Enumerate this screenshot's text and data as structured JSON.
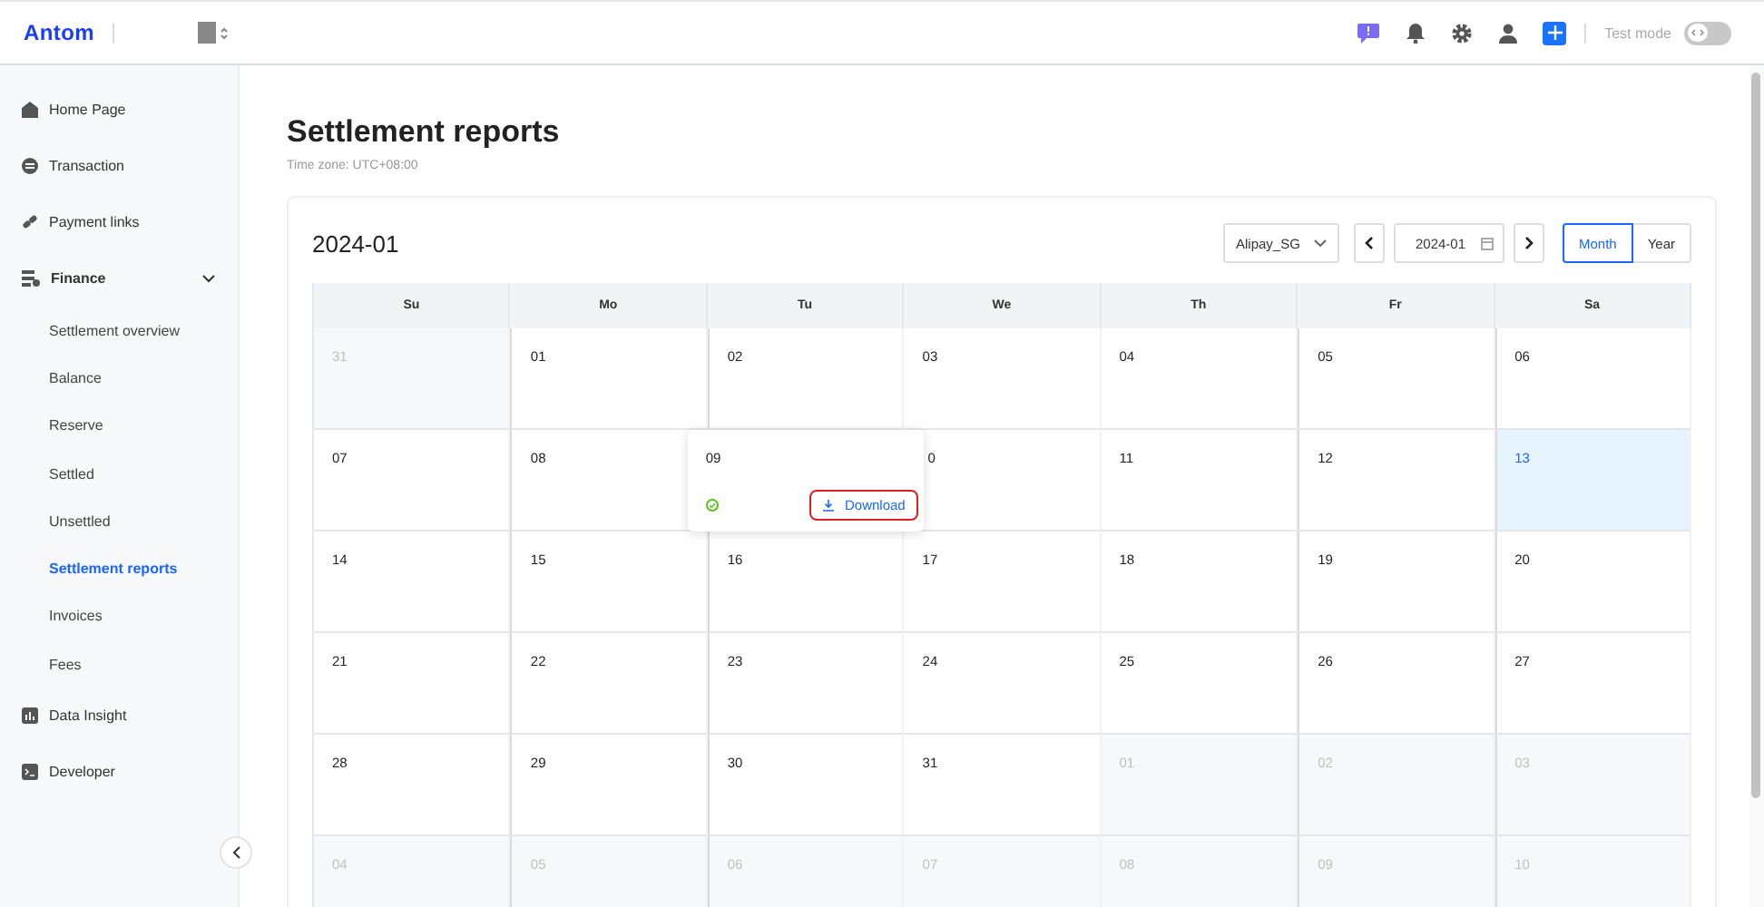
{
  "header": {
    "logo": "Antom",
    "test_mode": {
      "label": "Test mode",
      "on": false
    }
  },
  "sidebar": {
    "items": [
      {
        "label": "Home Page",
        "kind": "home",
        "expanded": false
      },
      {
        "label": "Transaction",
        "kind": "transaction",
        "expanded": false
      },
      {
        "label": "Payment links",
        "kind": "link",
        "expanded": false
      },
      {
        "label": "Finance",
        "kind": "finance",
        "expanded": true,
        "children": [
          {
            "label": "Settlement overview",
            "selected": false
          },
          {
            "label": "Balance",
            "selected": false
          },
          {
            "label": "Reserve",
            "selected": false
          },
          {
            "label": "Settled",
            "selected": false
          },
          {
            "label": "Unsettled",
            "selected": false
          },
          {
            "label": "Settlement reports",
            "selected": true
          },
          {
            "label": "Invoices",
            "selected": false
          },
          {
            "label": "Fees",
            "selected": false
          }
        ]
      },
      {
        "label": "Data Insight",
        "kind": "chart",
        "expanded": false
      },
      {
        "label": "Developer",
        "kind": "terminal",
        "expanded": false
      }
    ]
  },
  "page": {
    "title": "Settlement reports",
    "subtitle": "Time zone: UTC+08:00"
  },
  "calendar": {
    "period": "2024-01",
    "account": "Alipay_SG",
    "date": "2024-01",
    "views": [
      {
        "label": "Month",
        "selected": true
      },
      {
        "label": "Year",
        "selected": false
      }
    ],
    "weekdays": [
      "Su",
      "Mo",
      "Tu",
      "We",
      "Th",
      "Fr",
      "Sa"
    ],
    "weeks": [
      [
        {
          "day": "31",
          "in_month": false,
          "selected": false
        },
        {
          "day": "01",
          "in_month": true,
          "selected": false
        },
        {
          "day": "02",
          "in_month": true,
          "selected": false
        },
        {
          "day": "03",
          "in_month": true,
          "selected": false
        },
        {
          "day": "04",
          "in_month": true,
          "selected": false
        },
        {
          "day": "05",
          "in_month": true,
          "selected": false
        },
        {
          "day": "06",
          "in_month": true,
          "selected": false
        }
      ],
      [
        {
          "day": "07",
          "in_month": true,
          "selected": false
        },
        {
          "day": "08",
          "in_month": true,
          "selected": false
        },
        {
          "day": "09",
          "in_month": true,
          "selected": false,
          "popover": {
            "completed": true,
            "action": "Download",
            "highlighted": true
          }
        },
        {
          "day": "0",
          "in_month": true,
          "selected": false
        },
        {
          "day": "11",
          "in_month": true,
          "selected": false
        },
        {
          "day": "12",
          "in_month": true,
          "selected": false
        },
        {
          "day": "13",
          "in_month": true,
          "selected": true
        }
      ],
      [
        {
          "day": "14",
          "in_month": true,
          "selected": false
        },
        {
          "day": "15",
          "in_month": true,
          "selected": false
        },
        {
          "day": "16",
          "in_month": true,
          "selected": false
        },
        {
          "day": "17",
          "in_month": true,
          "selected": false
        },
        {
          "day": "18",
          "in_month": true,
          "selected": false
        },
        {
          "day": "19",
          "in_month": true,
          "selected": false
        },
        {
          "day": "20",
          "in_month": true,
          "selected": false
        }
      ],
      [
        {
          "day": "21",
          "in_month": true,
          "selected": false
        },
        {
          "day": "22",
          "in_month": true,
          "selected": false
        },
        {
          "day": "23",
          "in_month": true,
          "selected": false
        },
        {
          "day": "24",
          "in_month": true,
          "selected": false
        },
        {
          "day": "25",
          "in_month": true,
          "selected": false
        },
        {
          "day": "26",
          "in_month": true,
          "selected": false
        },
        {
          "day": "27",
          "in_month": true,
          "selected": false
        }
      ],
      [
        {
          "day": "28",
          "in_month": true,
          "selected": false
        },
        {
          "day": "29",
          "in_month": true,
          "selected": false
        },
        {
          "day": "30",
          "in_month": true,
          "selected": false
        },
        {
          "day": "31",
          "in_month": true,
          "selected": false
        },
        {
          "day": "01",
          "in_month": false,
          "selected": false
        },
        {
          "day": "02",
          "in_month": false,
          "selected": false
        },
        {
          "day": "03",
          "in_month": false,
          "selected": false
        }
      ],
      [
        {
          "day": "04",
          "in_month": false,
          "selected": false
        },
        {
          "day": "05",
          "in_month": false,
          "selected": false
        },
        {
          "day": "06",
          "in_month": false,
          "selected": false
        },
        {
          "day": "07",
          "in_month": false,
          "selected": false
        },
        {
          "day": "08",
          "in_month": false,
          "selected": false
        },
        {
          "day": "09",
          "in_month": false,
          "selected": false
        },
        {
          "day": "10",
          "in_month": false,
          "selected": false
        }
      ]
    ]
  }
}
